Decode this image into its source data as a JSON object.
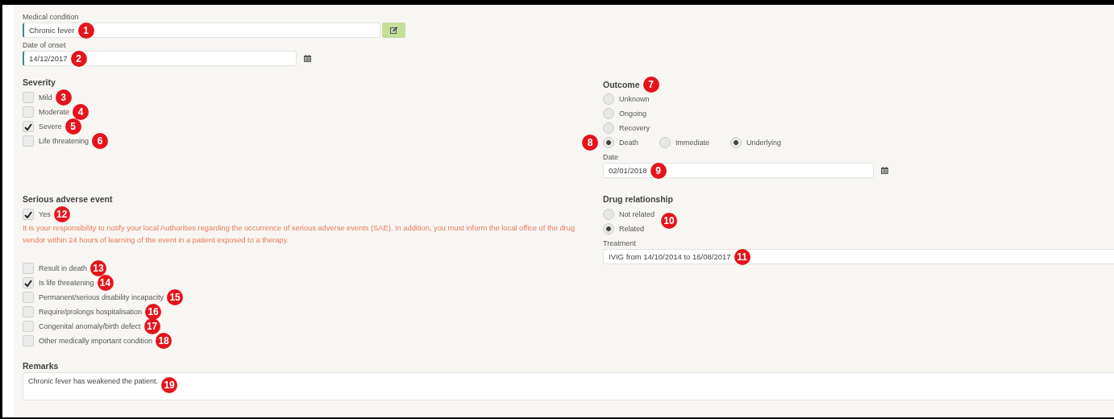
{
  "medical_condition": {
    "label": "Medical condition",
    "value": "Chronic fever",
    "marker": "1"
  },
  "date_of_onset": {
    "label": "Date of onset",
    "value": "14/12/2017",
    "marker": "2"
  },
  "severity": {
    "title": "Severity",
    "options": [
      {
        "label": "Mild",
        "checked": false,
        "marker": "3"
      },
      {
        "label": "Moderate",
        "checked": false,
        "marker": "4"
      },
      {
        "label": "Severe",
        "checked": true,
        "marker": "5"
      },
      {
        "label": "Life threatening",
        "checked": false,
        "marker": "6"
      }
    ]
  },
  "outcome": {
    "title": "Outcome",
    "marker": "7",
    "options": [
      {
        "label": "Unknown",
        "selected": false
      },
      {
        "label": "Ongoing",
        "selected": false
      },
      {
        "label": "Recovery",
        "selected": false
      },
      {
        "label": "Death",
        "selected": true,
        "marker": "8",
        "sub_options": [
          {
            "label": "Immediate",
            "selected": false
          },
          {
            "label": "Underlying",
            "selected": true
          }
        ]
      }
    ],
    "date": {
      "label": "Date",
      "value": "02/01/2018",
      "marker": "9"
    }
  },
  "serious_adverse_event": {
    "title": "Serious adverse event",
    "yes": {
      "label": "Yes",
      "checked": true,
      "marker": "12"
    },
    "warning": "It is your responsibility to notify your local Authorities regarding the occurrence of serious adverse events (SAE). In addition, you must inform the local office of the drug vendor within 24 hours of learning of the event in a patient exposed to a therapy.",
    "criteria": [
      {
        "label": "Result in death",
        "checked": false,
        "marker": "13"
      },
      {
        "label": "Is life threatening",
        "checked": true,
        "marker": "14"
      },
      {
        "label": "Permanent/serious disability incapacity",
        "checked": false,
        "marker": "15"
      },
      {
        "label": "Require/prolongs hospitalisation",
        "checked": false,
        "marker": "16"
      },
      {
        "label": "Congenital anomaly/birth defect",
        "checked": false,
        "marker": "17"
      },
      {
        "label": "Other medically important condition",
        "checked": false,
        "marker": "18"
      }
    ]
  },
  "drug_relationship": {
    "title": "Drug relationship",
    "options": [
      {
        "label": "Not related",
        "selected": false,
        "marker": "10"
      },
      {
        "label": "Related",
        "selected": true
      }
    ],
    "treatment": {
      "label": "Treatment",
      "value": "IVIG from 14/10/2014 to 16/08/2017",
      "marker": "11"
    }
  },
  "remarks": {
    "title": "Remarks",
    "value": "Chronic fever has weakened the patient.",
    "marker": "19"
  }
}
